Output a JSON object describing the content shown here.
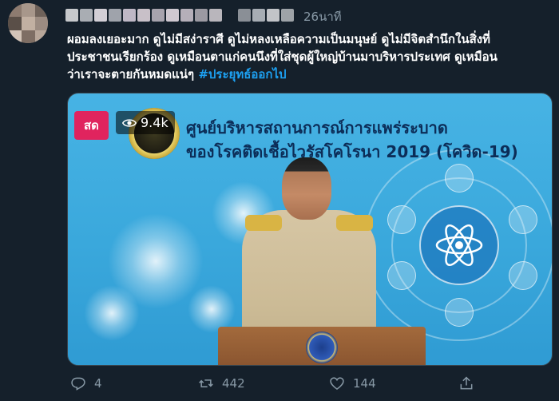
{
  "tweet": {
    "timestamp": "26นาที",
    "text_lines": [
      "ผอมลงเยอะมาก ดูไม่มีสง่าราศี ดูไม่หลงเหลือความเป็นมนุษย์ ดูไม่มีจิตสำนึกในสิ่งที่",
      "ประชาชนเรียกร้อง ดูเหมือนตาแก่คนนึงที่ใส่ชุดผู้ใหญ่บ้านมาบริหารประเทศ ดูเหมือน",
      "ว่าเราจะตายกันหมดแน่ๆ"
    ],
    "hashtag": "#ประยุทธ์ออกไป"
  },
  "media": {
    "live_label": "สด",
    "views": "9.4k",
    "video_title_line1": "ศูนย์บริหารสถานการณ์การแพร่ระบาด",
    "video_title_line2": "ของโรคติดเชื้อไวรัสโคโรนา 2019 (โควิด-19)"
  },
  "actions": {
    "reply_count": "4",
    "retweet_count": "442",
    "like_count": "144"
  },
  "icons": {
    "reply": "reply-icon",
    "retweet": "retweet-icon",
    "like": "heart-icon",
    "share": "share-icon",
    "views": "eye-icon"
  },
  "colors": {
    "background": "#15202b",
    "accent": "#1da1f2",
    "muted": "#8899a6",
    "live": "#e0245e"
  }
}
